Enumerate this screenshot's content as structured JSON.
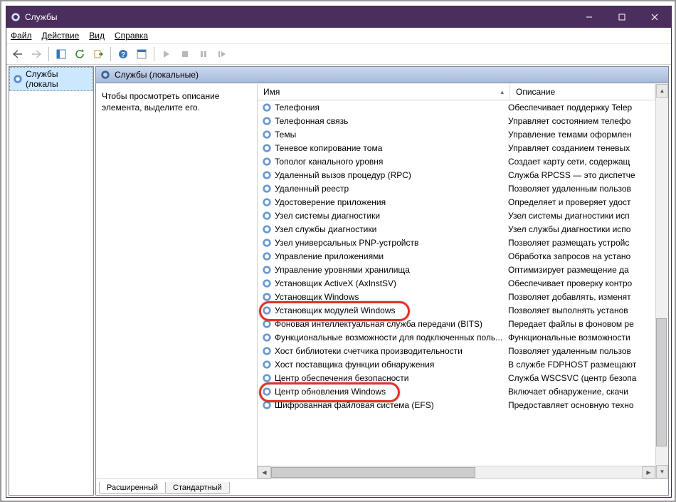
{
  "window": {
    "title": "Службы"
  },
  "menu": {
    "file": "Файл",
    "action": "Действие",
    "view": "Вид",
    "help": "Справка"
  },
  "tree": {
    "root": "Службы (локалы"
  },
  "subheader": "Службы (локальные)",
  "description": "Чтобы просмотреть описание элемента, выделите его.",
  "columns": {
    "name": "Имя",
    "desc": "Описание"
  },
  "tabs": {
    "extended": "Расширенный",
    "standard": "Стандартный"
  },
  "services": [
    {
      "name": "Телефония",
      "desc": "Обеспечивает поддержку Telep"
    },
    {
      "name": "Телефонная связь",
      "desc": "Управляет состоянием телефо"
    },
    {
      "name": "Темы",
      "desc": "Управление темами оформлен"
    },
    {
      "name": "Теневое копирование тома",
      "desc": "Управляет созданием теневых "
    },
    {
      "name": "Тополог канального уровня",
      "desc": "Создает карту сети, содержащ"
    },
    {
      "name": "Удаленный вызов процедур (RPC)",
      "desc": "Служба RPCSS — это диспетче"
    },
    {
      "name": "Удаленный реестр",
      "desc": "Позволяет удаленным пользов"
    },
    {
      "name": "Удостоверение приложения",
      "desc": "Определяет и проверяет удост"
    },
    {
      "name": "Узел системы диагностики",
      "desc": "Узел системы диагностики исп"
    },
    {
      "name": "Узел службы диагностики",
      "desc": "Узел службы диагностики испо"
    },
    {
      "name": "Узел универсальных PNP-устройств",
      "desc": "Позволяет размещать устройс"
    },
    {
      "name": "Управление приложениями",
      "desc": "Обработка запросов на устано"
    },
    {
      "name": "Управление уровнями хранилища",
      "desc": "Оптимизирует размещение да"
    },
    {
      "name": "Установщик ActiveX (AxInstSV)",
      "desc": "Обеспечивает проверку контро"
    },
    {
      "name": "Установщик Windows",
      "desc": "Позволяет добавлять, изменят"
    },
    {
      "name": "Установщик модулей Windows",
      "desc": "Позволяет выполнять установ"
    },
    {
      "name": "Фоновая интеллектуальная служба передачи (BITS)",
      "desc": "Передает файлы в фоновом ре"
    },
    {
      "name": "Функциональные возможности для подключенных поль...",
      "desc": "Функциональные возможности"
    },
    {
      "name": "Хост библиотеки счетчика производительности",
      "desc": "Позволяет удаленным пользов"
    },
    {
      "name": "Хост поставщика функции обнаружения",
      "desc": "В службе FDPHOST размещают"
    },
    {
      "name": "Центр обеспечения безопасности",
      "desc": "Служба WSCSVC (центр безопа"
    },
    {
      "name": "Центр обновления Windows",
      "desc": "Включает обнаружение, скачи"
    },
    {
      "name": "Шифрованная файловая система (EFS)",
      "desc": "Предоставляет основную техно"
    }
  ],
  "highlights": [
    15,
    21
  ]
}
